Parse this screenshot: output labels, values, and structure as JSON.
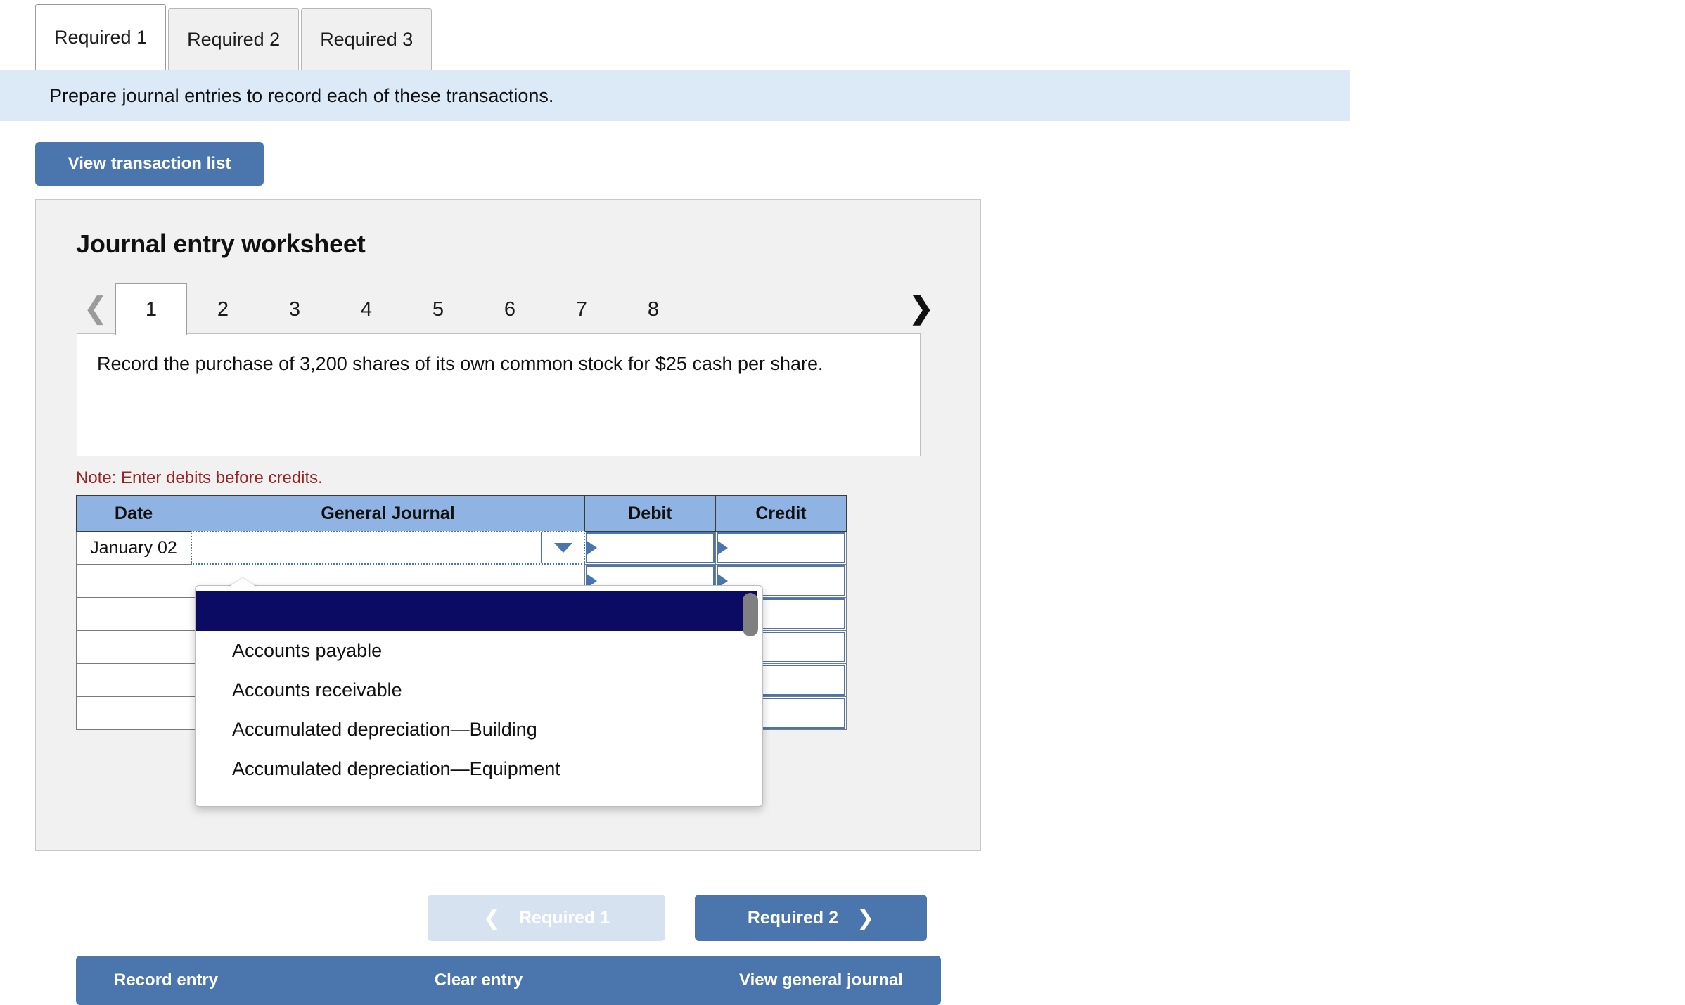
{
  "requirement_tabs": [
    {
      "label": "Required 1",
      "active": true
    },
    {
      "label": "Required 2",
      "active": false
    },
    {
      "label": "Required 3",
      "active": false
    }
  ],
  "instruction": "Prepare journal entries to record each of these transactions.",
  "view_transaction_list_label": "View transaction list",
  "worksheet": {
    "title": "Journal entry worksheet",
    "pager": {
      "prev_icon": "chevron-left-icon",
      "next_icon": "chevron-right-icon",
      "pages": [
        "1",
        "2",
        "3",
        "4",
        "5",
        "6",
        "7",
        "8"
      ],
      "active_page": "1"
    },
    "transaction_text": "Record the purchase of 3,200 shares of its own common stock for $25 cash per share.",
    "note": "Note: Enter debits before credits.",
    "table": {
      "headers": [
        "Date",
        "General Journal",
        "Debit",
        "Credit"
      ],
      "rows": [
        {
          "date": "January 02",
          "general_journal": "",
          "debit": "",
          "credit": ""
        },
        {
          "date": "",
          "general_journal": "",
          "debit": "",
          "credit": ""
        },
        {
          "date": "",
          "general_journal": "",
          "debit": "",
          "credit": ""
        },
        {
          "date": "",
          "general_journal": "",
          "debit": "",
          "credit": ""
        },
        {
          "date": "",
          "general_journal": "",
          "debit": "",
          "credit": ""
        },
        {
          "date": "",
          "general_journal": "",
          "debit": "",
          "credit": ""
        }
      ]
    },
    "footer": {
      "record_entry_label": "Record entry",
      "clear_entry_label": "Clear entry",
      "view_general_journal_label": "View general journal"
    }
  },
  "account_dropdown": {
    "selected_value": "",
    "options": [
      "Accounts payable",
      "Accounts receivable",
      "Accumulated depreciation—Building",
      "Accumulated depreciation—Equipment"
    ],
    "scrollbar_icon": "scrollbar-thumb"
  },
  "bottom_nav": {
    "prev_label": "Required 1",
    "prev_icon": "chevron-left-icon",
    "prev_disabled": true,
    "next_label": "Required 2",
    "next_icon": "chevron-right-icon"
  },
  "colors": {
    "accent_blue": "#4a76ad",
    "table_header_blue": "#8fb4e3",
    "instruction_bar": "#dce9f7",
    "panel_gray": "#f1f1f1",
    "note_red": "#9d2323",
    "dropdown_selected": "#0b0b63",
    "disabled_button": "#d6e2ef"
  }
}
